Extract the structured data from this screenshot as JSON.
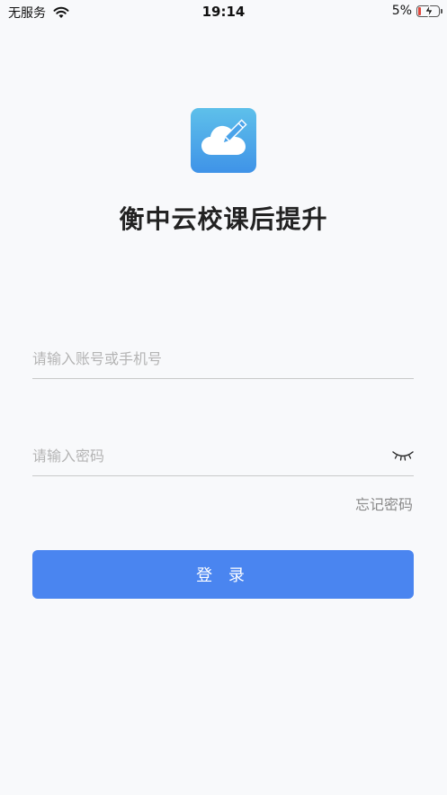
{
  "status_bar": {
    "carrier": "无服务",
    "time": "19:14",
    "battery_percent": "5%",
    "battery_level": 0.05,
    "battery_level_color": "#e0453a"
  },
  "app": {
    "logo_icon": "cloud-pencil-icon",
    "logo_gradient": [
      "#5ec0ea",
      "#3f93e8"
    ],
    "title": "衡中云校课后提升"
  },
  "form": {
    "account_placeholder": "请输入账号或手机号",
    "password_placeholder": "请输入密码",
    "password_toggle_icon": "eye-closed-icon",
    "forgot_label": "忘记密码",
    "login_label": "登 录",
    "login_color": "#4a85f0"
  }
}
